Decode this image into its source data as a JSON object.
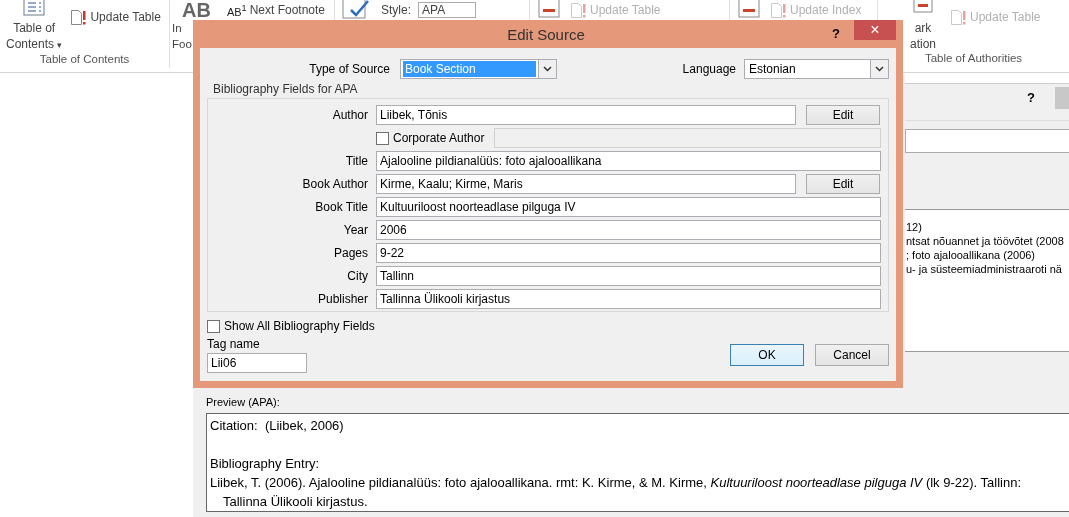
{
  "ribbon": {
    "groups": [
      {
        "kind": "toc",
        "large_lines": [
          "Table of",
          "Contents"
        ],
        "dropdown_glyph": "▾",
        "small_buttons": [
          {
            "label": "Update Table",
            "disabled": false
          }
        ],
        "group_label": "Table of Contents"
      },
      {
        "kind": "footnotes",
        "big_glyph": "AB",
        "large_lines": [
          "In",
          "Foo"
        ],
        "small_glyph": "AB$^{1}$",
        "next_label": "Next Footnote"
      },
      {
        "kind": "citations",
        "style_label": "Style:",
        "style_value": "APA"
      },
      {
        "kind": "captions",
        "small_buttons": [
          {
            "label": "Update Table",
            "disabled": true
          }
        ]
      },
      {
        "kind": "index",
        "small_buttons": [
          {
            "label": "Update Index",
            "disabled": true
          }
        ]
      },
      {
        "kind": "authorities",
        "large_lines": [
          "ark",
          "ation"
        ],
        "small_buttons": [
          {
            "label": "Update Table",
            "disabled": true
          }
        ],
        "group_label": "Table of Authorities"
      }
    ]
  },
  "source_manager": {
    "help": "?",
    "list_items": [
      "12)",
      "ntsat nõuannet ja töövõtet (2008",
      "; foto ajalooallikana (2006)",
      "u- ja süsteemiadministraaroti nä"
    ],
    "preview_label": "Preview (APA):",
    "preview_lines": [
      {
        "kind": "text",
        "text": "Citation:  (Liibek, 2006)"
      },
      {
        "kind": "blank"
      },
      {
        "kind": "text",
        "text": "Bibliography Entry:"
      },
      {
        "kind": "hanging",
        "text": "Liibek, T. (2006). Ajalooline pildianalüüs: foto ajalooallikana. rmt: K. Kirme, & M. Kirme, *Kultuuriloost noorteadlase pilguga IV* (lk 9-22). Tallinn: Tallinna Ülikooli kirjastus."
      }
    ]
  },
  "edit_source": {
    "title": "Edit Source",
    "help": "?",
    "close": "×",
    "type_label": "Type of Source",
    "type_value": "Book Section",
    "language_label": "Language",
    "language_value": "Estonian",
    "group_title": "Bibliography Fields for APA",
    "fields": [
      {
        "kind": "edit",
        "label": "Author",
        "value": "Liibek, Tõnis",
        "button": "Edit"
      },
      {
        "kind": "checkbox",
        "label": "Corporate Author",
        "checked": false
      },
      {
        "kind": "text",
        "label": "Title",
        "value": "Ajalooline pildianalüüs: foto ajalooallikana"
      },
      {
        "kind": "edit",
        "label": "Book Author",
        "value": "Kirme, Kaalu; Kirme, Maris",
        "button": "Edit"
      },
      {
        "kind": "text",
        "label": "Book Title",
        "value": "Kultuuriloost noorteadlase pilguga IV"
      },
      {
        "kind": "text",
        "label": "Year",
        "value": "2006"
      },
      {
        "kind": "text",
        "label": "Pages",
        "value": "9-22"
      },
      {
        "kind": "text",
        "label": "City",
        "value": "Tallinn"
      },
      {
        "kind": "text",
        "label": "Publisher",
        "value": "Tallinna Ülikooli kirjastus"
      }
    ],
    "show_all": {
      "label": "Show All Bibliography Fields",
      "checked": false
    },
    "tag_label": "Tag name",
    "tag_value": "Lii06",
    "buttons": [
      {
        "label": "OK",
        "default": true
      },
      {
        "label": "Cancel",
        "default": false
      }
    ]
  }
}
